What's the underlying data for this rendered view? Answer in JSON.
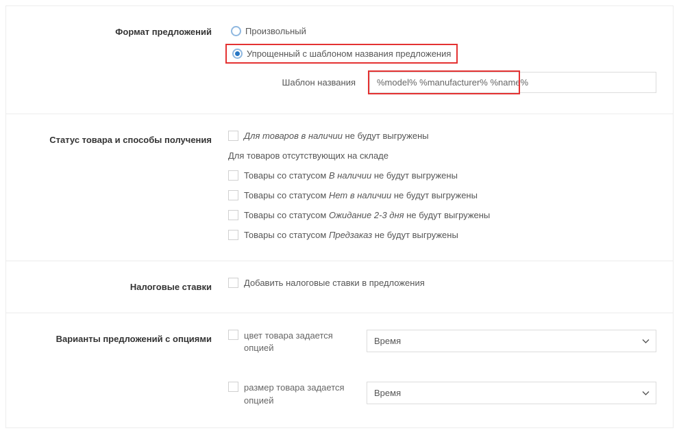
{
  "format": {
    "section_label": "Формат предложений",
    "radio_arbitrary": "Произвольный",
    "radio_simplified": "Упрощенный с шаблоном названия предложения",
    "template_sublabel": "Шаблон названия",
    "template_value": "%model% %manufacturer% %name%",
    "selected": "simplified"
  },
  "status": {
    "section_label": "Статус товара и способы получения",
    "instock_prefix": "Для товаров в наличии",
    "instock_suffix": " не будут выгружены",
    "oos_note": "Для товаров отсутствующих на складе",
    "line_prefix": "Товары со статусом ",
    "line_suffix": " не будут выгружены",
    "statuses": [
      "В наличии",
      "Нет в наличии",
      "Ожидание 2-3 дня",
      "Предзаказ"
    ]
  },
  "tax": {
    "section_label": "Налоговые ставки",
    "checkbox_label": "Добавить налоговые ставки в предложения"
  },
  "options": {
    "section_label": "Варианты предложений с опциями",
    "color_label": "цвет товара задается опцией",
    "size_label": "размер товара задается опцией",
    "color_selected": "Время",
    "size_selected": "Время"
  }
}
